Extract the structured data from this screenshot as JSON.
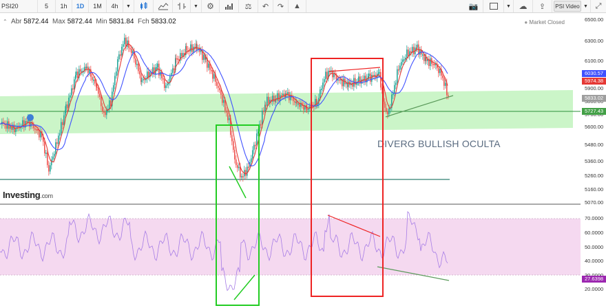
{
  "toolbar": {
    "symbol": "PSI20",
    "intervals": [
      "5",
      "1h",
      "1D",
      "1M",
      "4h"
    ],
    "active_interval": "1D",
    "psi_video": "PSI Video",
    "icons": [
      "candles-icon",
      "area-chart-icon",
      "bar-chart-icon",
      "gear-icon",
      "volume-icon",
      "balance-icon",
      "undo-icon",
      "redo-icon",
      "drawing-icon",
      "camera-icon",
      "square-icon",
      "cloud-icon",
      "upload-icon",
      "fullscreen-icon"
    ]
  },
  "ohlc": {
    "open_label": "Abr",
    "open": "5872.44",
    "max_label": "Max",
    "max": "5872.44",
    "min_label": "Min",
    "min": "5831.84",
    "close_label": "Fch",
    "close": "5833.02"
  },
  "status": "Market Closed",
  "annotation": "DIVERG BULLISH OCULTA",
  "logo": {
    "name": "Investing",
    "suffix": ".com"
  },
  "colors": {
    "up": "#26a69a",
    "down": "#ef5350",
    "ma_fast": "#e53935",
    "ma_slow": "#3f51ff",
    "zone": "#b9f2b5",
    "rsi": "#a67ce6",
    "rsi_band": "#f5d9f0",
    "green_box": "#22cc22",
    "red_box": "#ee2222",
    "tag_blue": "#3f51ff",
    "tag_red": "#e53935",
    "tag_green": "#43a047",
    "tag_purple": "#9c27b0"
  },
  "price_axis": {
    "ticks": [
      "6500.00",
      "6300.00",
      "6100.00",
      "5900.00",
      "5800.00",
      "5700.00",
      "5600.00",
      "5480.00",
      "5360.00",
      "5260.00",
      "5160.00",
      "5070.00"
    ],
    "tags": [
      {
        "value": "6030.57",
        "color": "blue"
      },
      {
        "value": "5974.38",
        "color": "red"
      },
      {
        "value": "5833.02",
        "color": "gray"
      },
      {
        "value": "5727.43",
        "color": "green"
      }
    ]
  },
  "rsi_axis": {
    "ticks": [
      "70.0000",
      "60.0000",
      "50.0000",
      "40.0000",
      "30.0000",
      "20.0000"
    ],
    "tag": "27.6398"
  }
}
